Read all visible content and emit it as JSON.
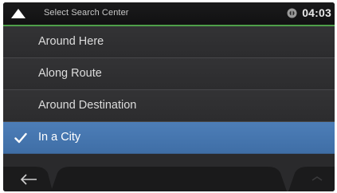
{
  "header": {
    "back_icon": "triangle-up-icon",
    "title": "Select Search Center",
    "status_icon": "signal-icon",
    "time": "04:03"
  },
  "menu": {
    "items": [
      {
        "label": "Around Here",
        "selected": false
      },
      {
        "label": "Along Route",
        "selected": false
      },
      {
        "label": "Around Destination",
        "selected": false
      },
      {
        "label": "In a City",
        "selected": true,
        "icon": "checkmark-icon"
      }
    ]
  },
  "footer": {
    "back_icon": "arrow-left-icon",
    "more_icon": "more-icon"
  },
  "colors": {
    "accent_green": "#4fa04a",
    "selected_blue": "#4676ae",
    "background": "#2b2b2d"
  }
}
